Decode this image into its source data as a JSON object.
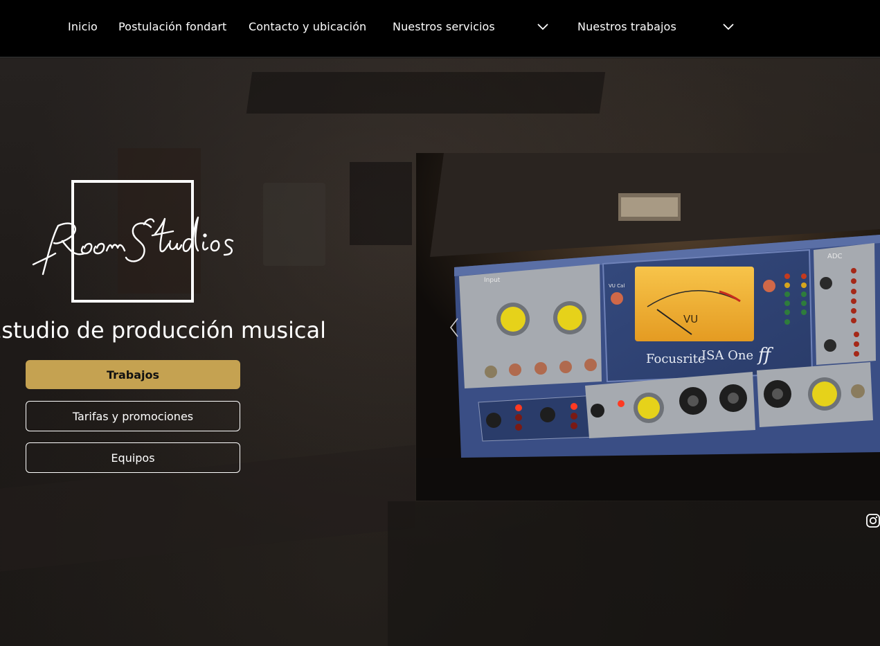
{
  "nav": {
    "items": [
      {
        "label": "Inicio"
      },
      {
        "label": "Postulación fondart"
      },
      {
        "label": "Contacto y ubicación"
      },
      {
        "label": "Nuestros servicios"
      },
      {
        "label": "Nuestros trabajos"
      }
    ]
  },
  "hero": {
    "logo_text": "Room Studios",
    "tagline": "Estudio de producción musical",
    "buttons": {
      "primary": "Trabajos",
      "rates": "Tarifas y promociones",
      "equipment": "Equipos"
    }
  },
  "gallery": {
    "device_brand": "Focusrite",
    "device_model": "ISA One",
    "panel_labels": {
      "adc": "ADC",
      "input": "Input",
      "vu": "VU",
      "vu_cal": "VU Cal"
    },
    "prev_icon": "chevron-left-icon"
  },
  "social": {
    "instagram_icon": "instagram-icon"
  },
  "colors": {
    "accent": "#c5a251",
    "nav_bg": "#000000",
    "page_bg": "#1b1816"
  }
}
